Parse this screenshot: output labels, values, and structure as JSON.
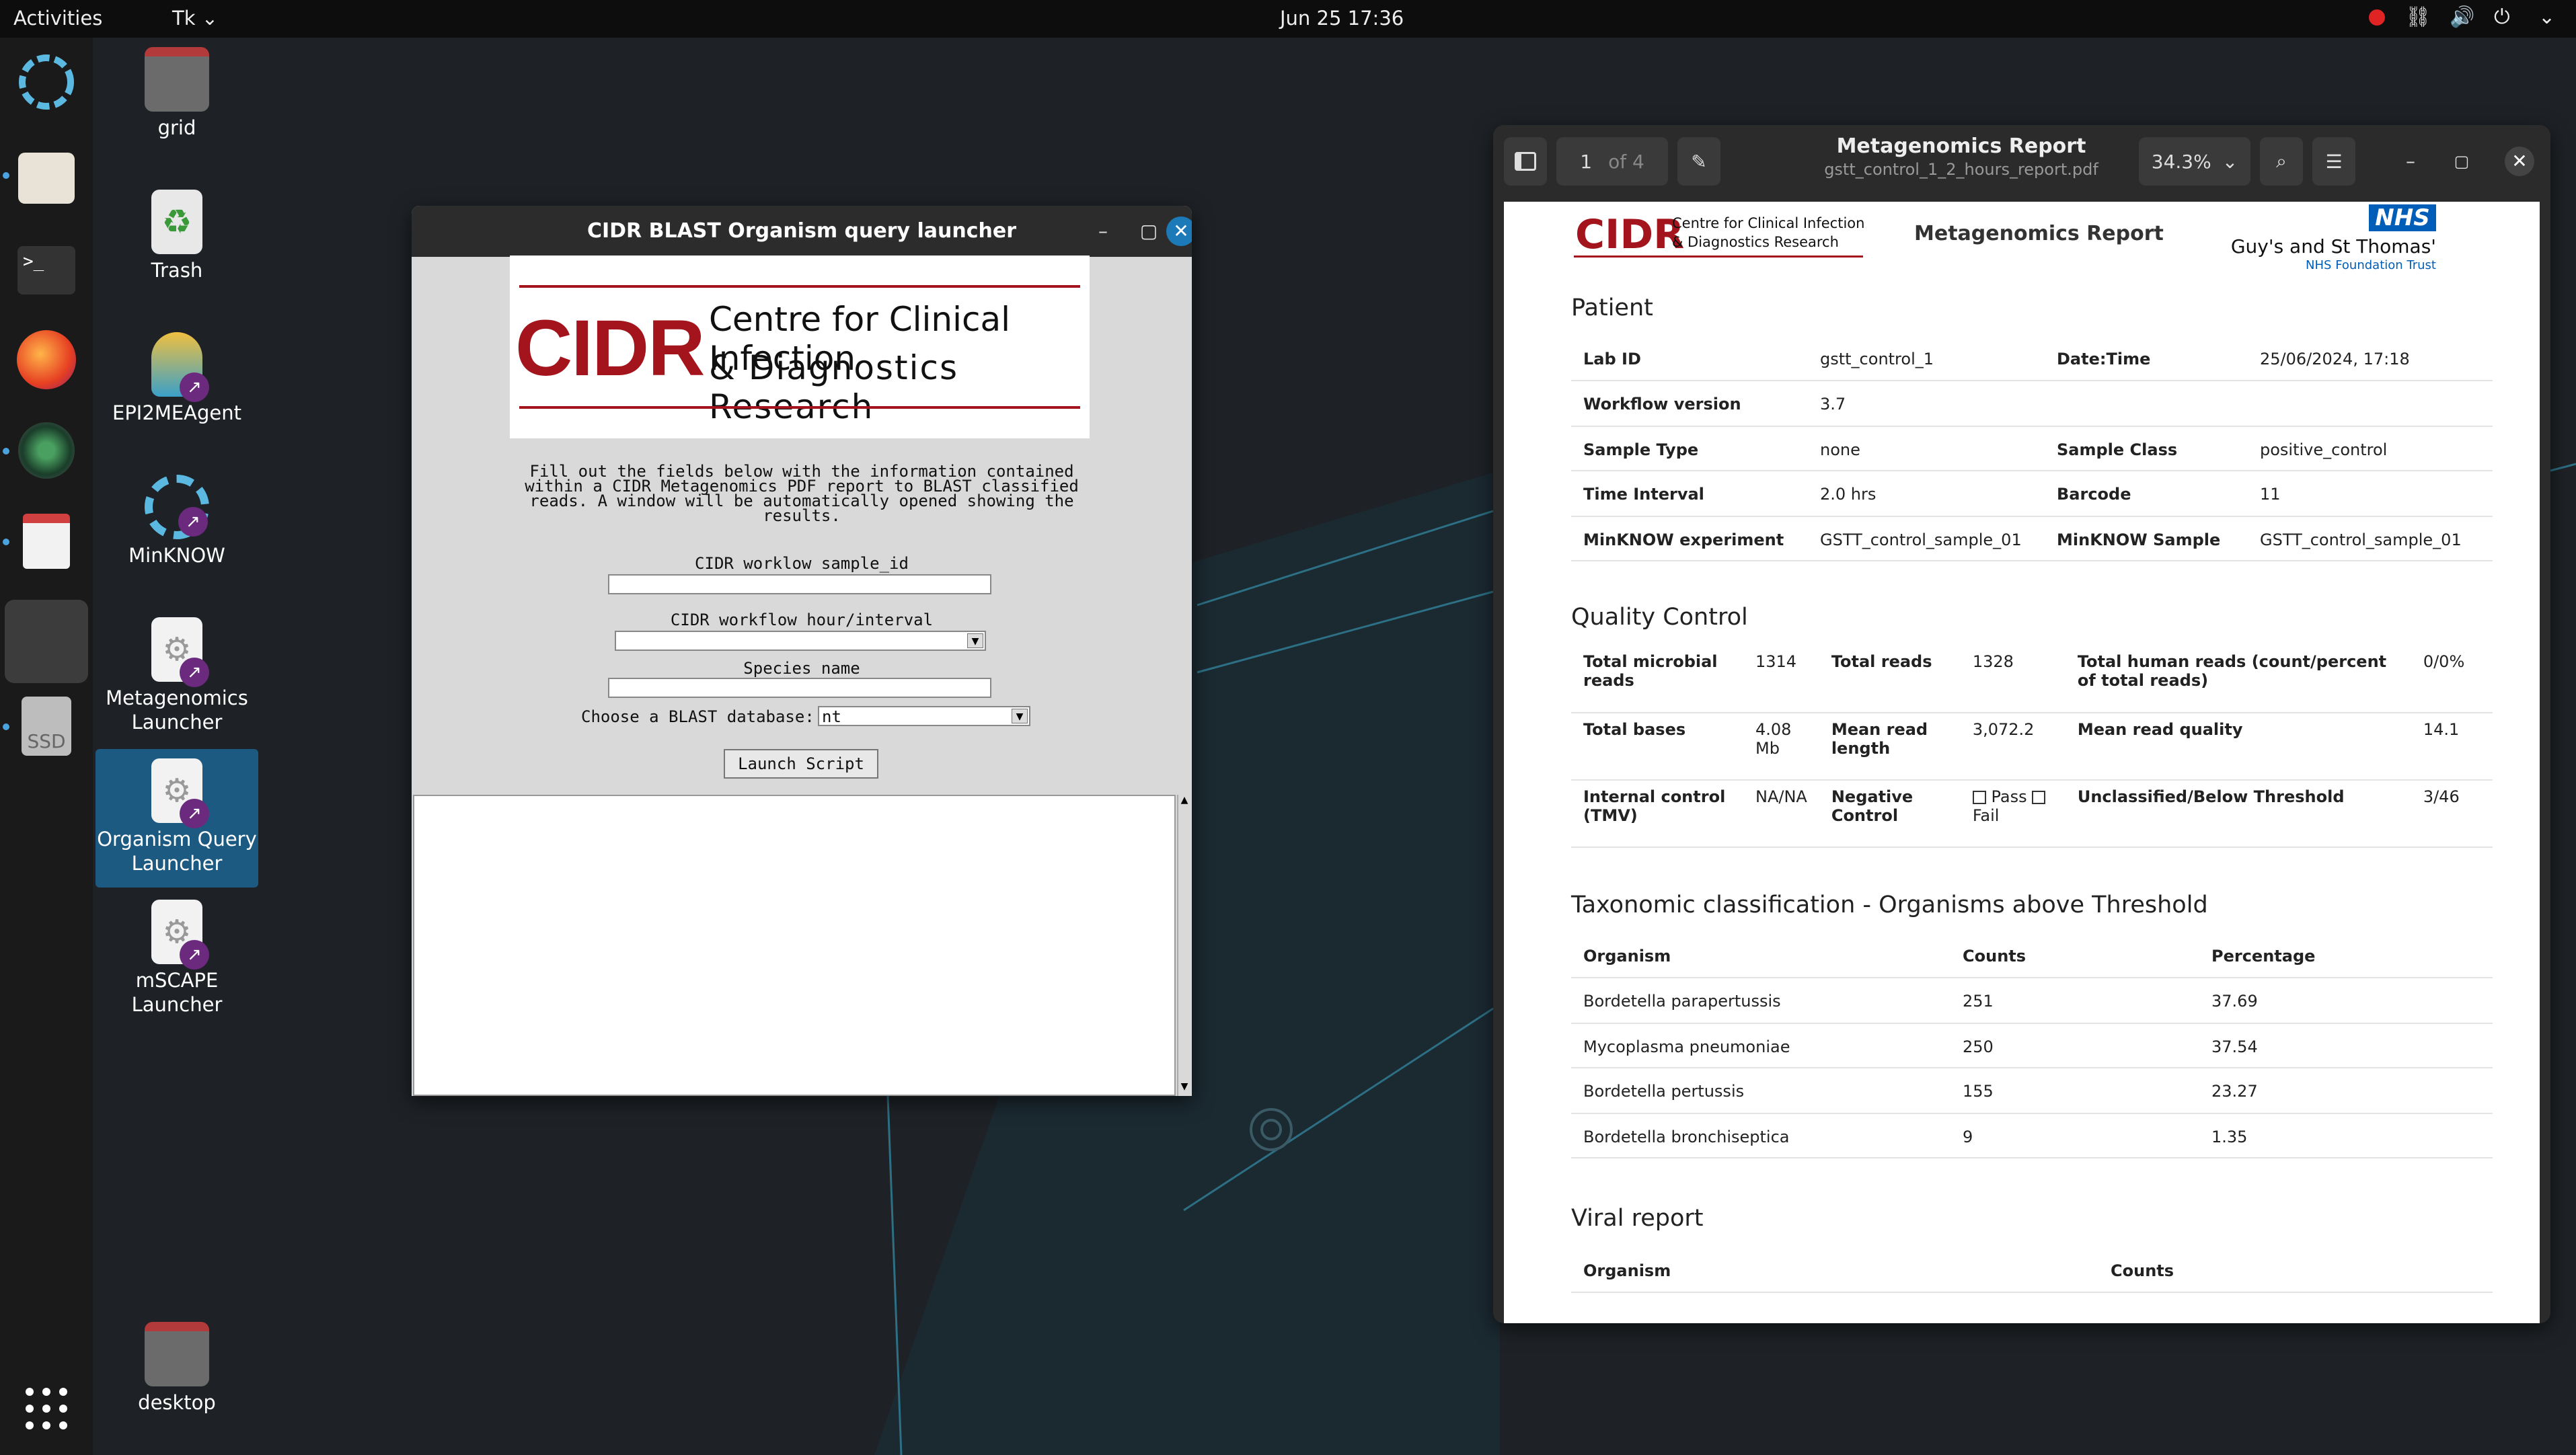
{
  "topbar": {
    "activities": "Activities",
    "app_menu": "Tk",
    "clock": "Jun 25  17:36"
  },
  "desktop_icons": [
    {
      "label": "grid",
      "icon": "home-folder-icon"
    },
    {
      "label": "Trash",
      "icon": "trash-icon"
    },
    {
      "label": "EPI2MEAgent",
      "icon": "epi2me-icon"
    },
    {
      "label": "MinKNOW",
      "icon": "minknow-icon"
    },
    {
      "label": "Metagenomics Launcher",
      "icon": "gear-launcher-icon"
    },
    {
      "label": "Organism Query Launcher",
      "icon": "gear-launcher-icon"
    },
    {
      "label": "mSCAPE Launcher",
      "icon": "gear-launcher-icon"
    },
    {
      "label": "desktop",
      "icon": "folder-icon"
    }
  ],
  "dock": {
    "ssd_label": "SSD"
  },
  "blast_window": {
    "title": "CIDR BLAST Organism query launcher",
    "logo_abbrev": "CIDR",
    "logo_line1": "Centre for Clinical Infection",
    "logo_line2": "& Diagnostics Research",
    "instructions": [
      "Fill out the fields below with the information contained",
      "within a CIDR Metagenomics PDF report to BLAST classified",
      "reads. A window will be automatically opened showing the",
      "results."
    ],
    "sample_id_label": "CIDR worklow sample_id",
    "interval_label": "CIDR workflow hour/interval",
    "species_label": "Species name",
    "db_label": "Choose a BLAST database:",
    "db_value": "nt",
    "launch_label": "Launch Script"
  },
  "pdf_window": {
    "title": "Metagenomics Report",
    "subtitle": "gstt_control_1_2_hours_report.pdf",
    "page_current": "1",
    "page_total": "of 4",
    "zoom": "34.3%",
    "report": {
      "cidr_abbrev": "CIDR",
      "cidr_line1": "Centre for Clinical Infection",
      "cidr_line2": "& Diagnostics Research",
      "heading": "Metagenomics Report",
      "nhs": "NHS",
      "trust_line1": "Guy's and St Thomas'",
      "trust_line2": "NHS Foundation Trust",
      "patient_title": "Patient",
      "patient": {
        "lab_id_k": "Lab ID",
        "lab_id_v": "gstt_control_1",
        "date_k": "Date:Time",
        "date_v": "25/06/2024, 17:18",
        "wf_k": "Workflow version",
        "wf_v": "3.7",
        "stype_k": "Sample Type",
        "stype_v": "none",
        "sclass_k": "Sample Class",
        "sclass_v": "positive_control",
        "ti_k": "Time Interval",
        "ti_v": "2.0 hrs",
        "bc_k": "Barcode",
        "bc_v": "11",
        "mexp_k": "MinKNOW experiment",
        "mexp_v": "GSTT_control_sample_01",
        "msamp_k": "MinKNOW Sample",
        "msamp_v": "GSTT_control_sample_01"
      },
      "qc_title": "Quality Control",
      "qc": {
        "tmr_k": "Total microbial reads",
        "tmr_v": "1314",
        "tr_k": "Total reads",
        "tr_v": "1328",
        "thr_k": "Total human reads (count/percent of total reads)",
        "thr_v": "0/0%",
        "tb_k": "Total bases",
        "tb_v": "4.08 Mb",
        "mrl_k": "Mean read length",
        "mrl_v": "3,072.2",
        "mrq_k": "Mean read quality",
        "mrq_v": "14.1",
        "ic_k": "Internal control (TMV)",
        "ic_v": "NA/NA",
        "nc_k": "Negative Control",
        "nc_pass": "Pass",
        "nc_fail": "Fail",
        "ub_k": "Unclassified/Below Threshold",
        "ub_v": "3/46"
      },
      "tax_title": "Taxonomic classification - Organisms above Threshold",
      "tax_headers": [
        "Organism",
        "Counts",
        "Percentage"
      ],
      "tax_rows": [
        [
          "Bordetella parapertussis",
          "251",
          "37.69"
        ],
        [
          "Mycoplasma pneumoniae",
          "250",
          "37.54"
        ],
        [
          "Bordetella pertussis",
          "155",
          "23.27"
        ],
        [
          "Bordetella bronchiseptica",
          "9",
          "1.35"
        ]
      ],
      "viral_title": "Viral report",
      "viral_headers": [
        "Organism",
        "Counts"
      ]
    }
  },
  "colors": {
    "cidr_red": "#a3141c",
    "nhs_blue": "#005eb8",
    "accent_blue": "#1d7ab8",
    "launcher_purple": "#6b2a7d"
  }
}
